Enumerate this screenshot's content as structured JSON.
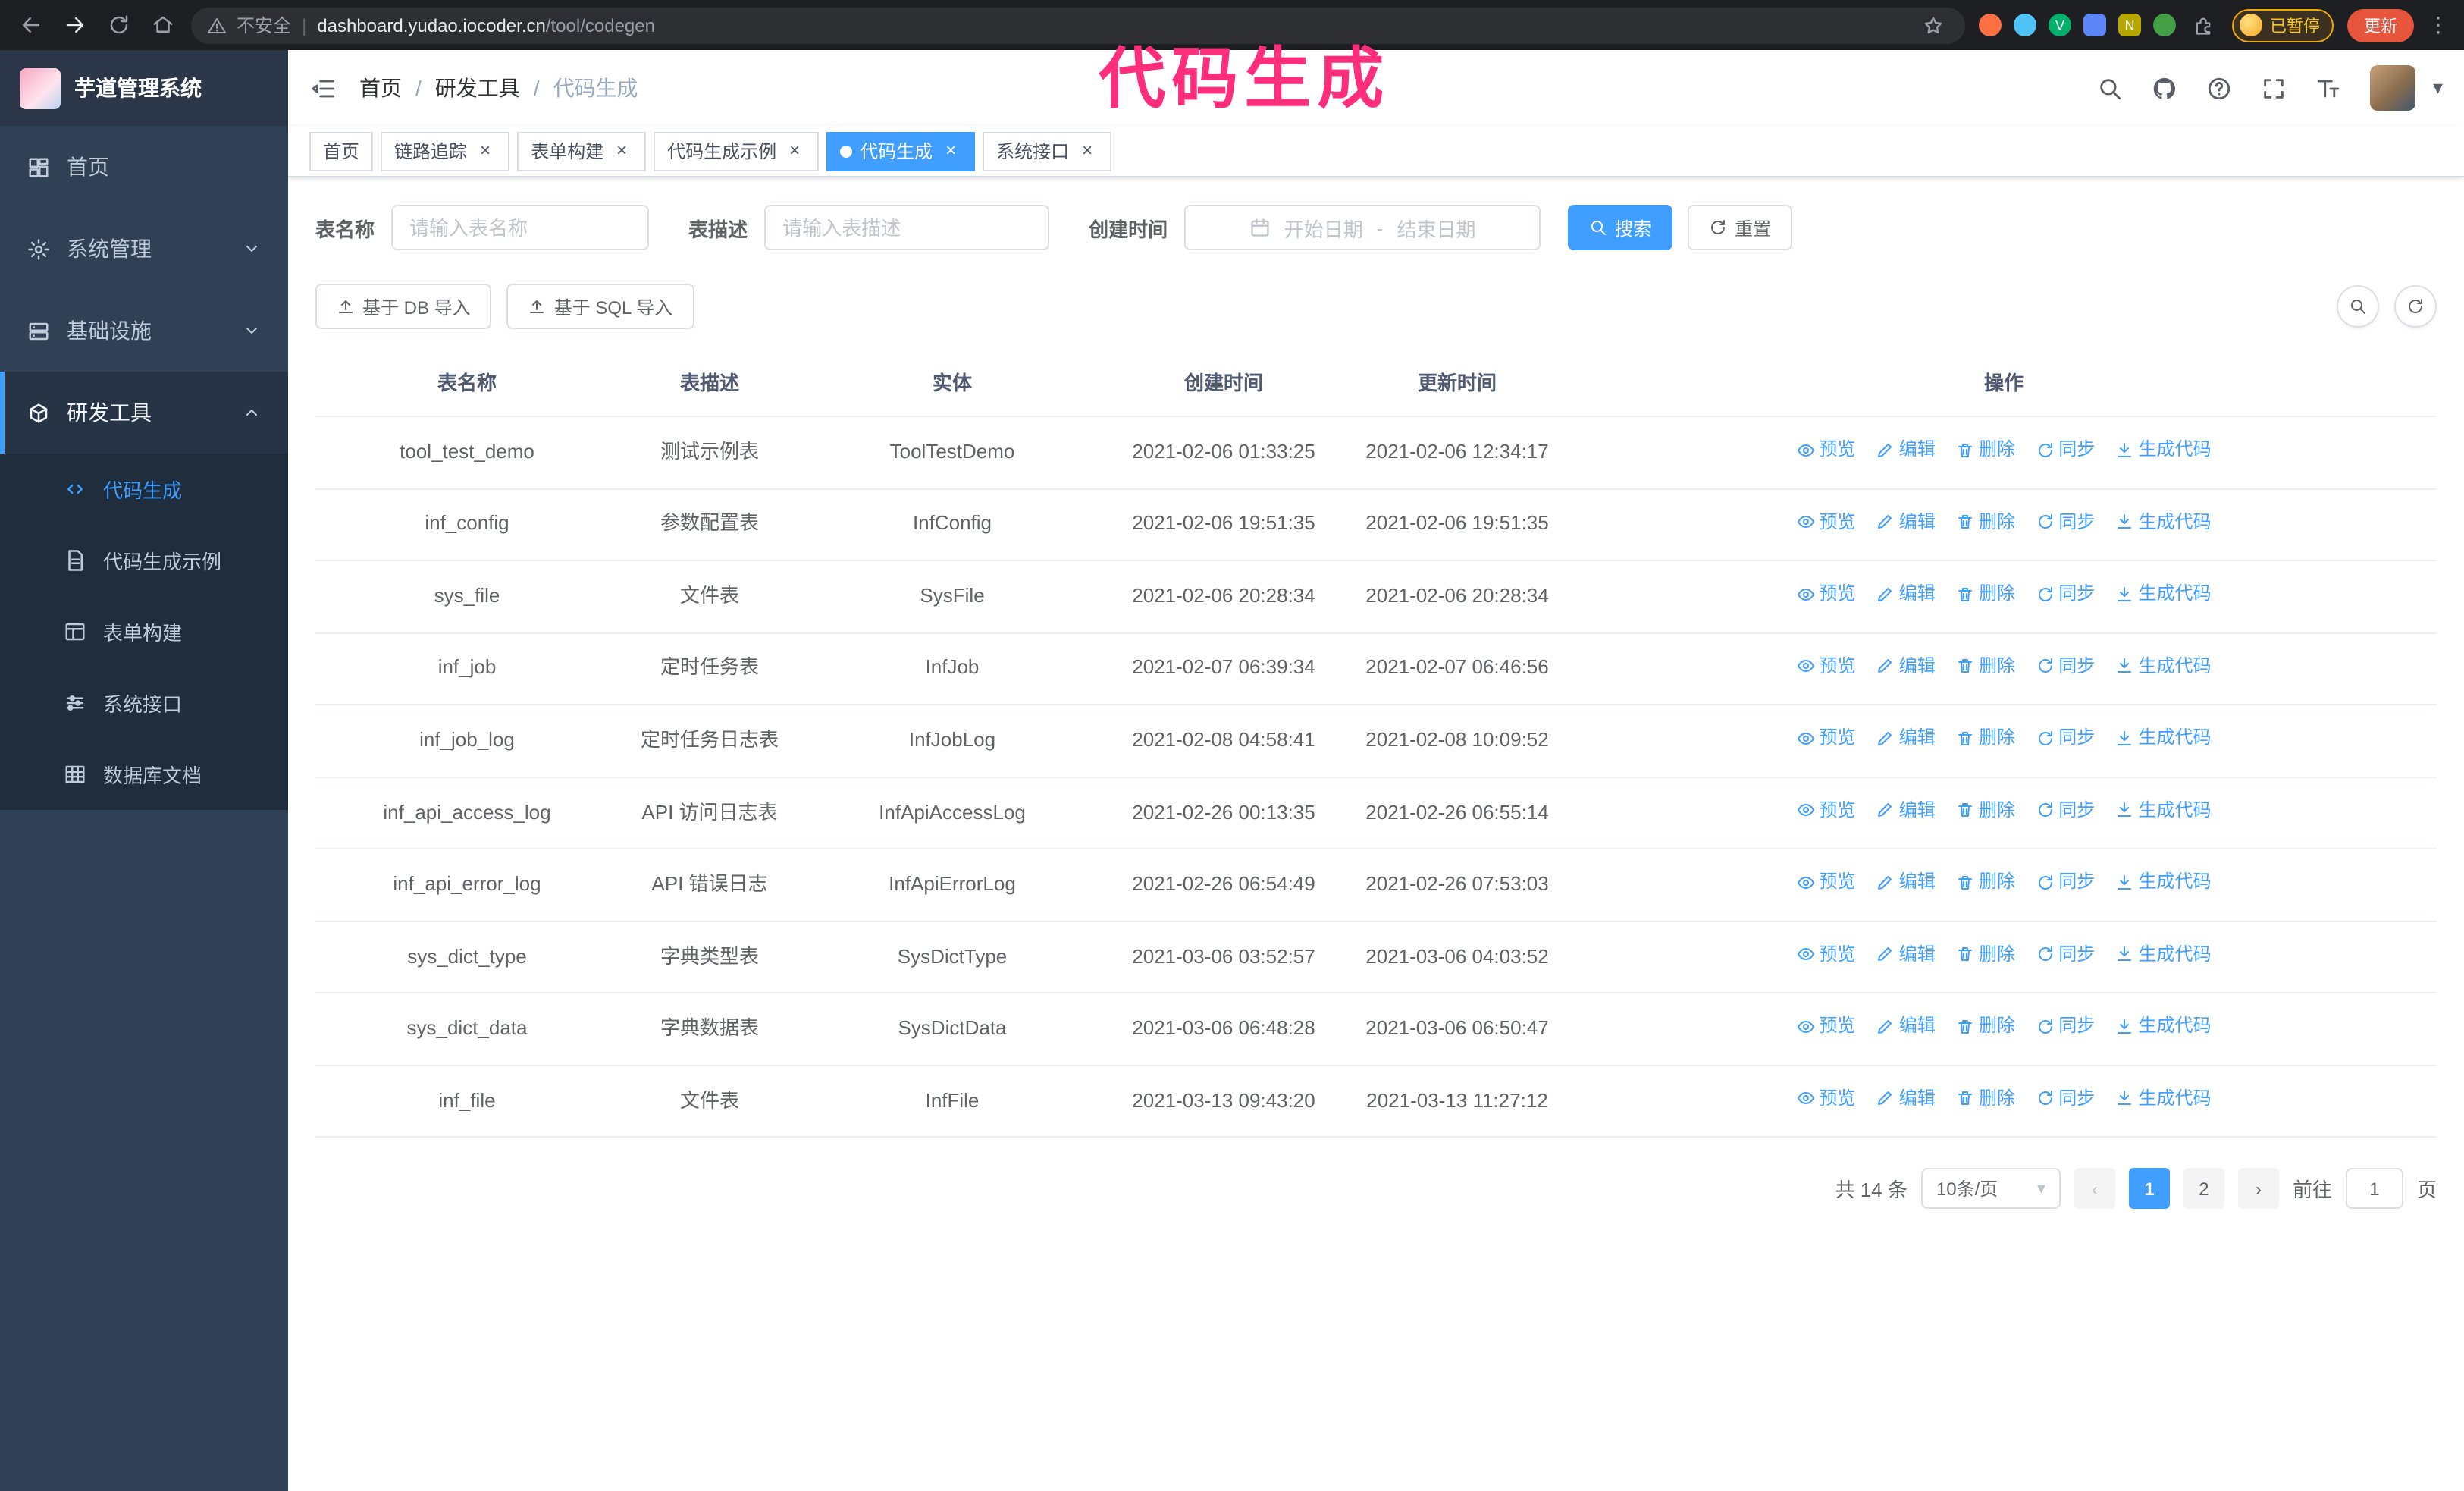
{
  "annotation": {
    "text": "代码生成",
    "color": "#ff2e7c"
  },
  "browser": {
    "security_label": "不安全",
    "url_host": "dashboard.yudao.iocoder.cn",
    "url_path": "/tool/codegen",
    "profile_badge": "已暂停",
    "update_button": "更新"
  },
  "icons": {
    "close": "×",
    "caret_down": "▾",
    "kebab": "⋮",
    "prev": "‹",
    "next": "›",
    "divider": "|",
    "date_separator": "-"
  },
  "sidebar": {
    "logo_title": "芋道管理系统",
    "menu": [
      {
        "label": "首页"
      },
      {
        "label": "系统管理"
      },
      {
        "label": "基础设施"
      },
      {
        "label": "研发工具"
      }
    ],
    "dev_submenu": [
      {
        "label": "代码生成"
      },
      {
        "label": "代码生成示例"
      },
      {
        "label": "表单构建"
      },
      {
        "label": "系统接口"
      },
      {
        "label": "数据库文档"
      }
    ]
  },
  "breadcrumb": {
    "items": [
      "首页",
      "研发工具",
      "代码生成"
    ],
    "separator": "/"
  },
  "tags": [
    {
      "label": "首页",
      "closable": false,
      "active": false
    },
    {
      "label": "链路追踪",
      "closable": true,
      "active": false
    },
    {
      "label": "表单构建",
      "closable": true,
      "active": false
    },
    {
      "label": "代码生成示例",
      "closable": true,
      "active": false
    },
    {
      "label": "代码生成",
      "closable": true,
      "active": true
    },
    {
      "label": "系统接口",
      "closable": true,
      "active": false
    }
  ],
  "filters": {
    "table_name_label": "表名称",
    "table_name_placeholder": "请输入表名称",
    "table_desc_label": "表描述",
    "table_desc_placeholder": "请输入表描述",
    "create_time_label": "创建时间",
    "date_start_placeholder": "开始日期",
    "date_end_placeholder": "结束日期",
    "search_button": "搜索",
    "reset_button": "重置"
  },
  "toolbar": {
    "import_db": "基于 DB 导入",
    "import_sql": "基于 SQL 导入"
  },
  "table": {
    "columns": [
      "表名称",
      "表描述",
      "实体",
      "创建时间",
      "更新时间",
      "操作"
    ],
    "actions": [
      "预览",
      "编辑",
      "删除",
      "同步",
      "生成代码"
    ],
    "rows": [
      {
        "name": "tool_test_demo",
        "desc": "测试示例表",
        "entity": "ToolTestDemo",
        "created": "2021-02-06 01:33:25",
        "updated": "2021-02-06 12:34:17"
      },
      {
        "name": "inf_config",
        "desc": "参数配置表",
        "entity": "InfConfig",
        "created": "2021-02-06 19:51:35",
        "updated": "2021-02-06 19:51:35"
      },
      {
        "name": "sys_file",
        "desc": "文件表",
        "entity": "SysFile",
        "created": "2021-02-06 20:28:34",
        "updated": "2021-02-06 20:28:34"
      },
      {
        "name": "inf_job",
        "desc": "定时任务表",
        "entity": "InfJob",
        "created": "2021-02-07 06:39:34",
        "updated": "2021-02-07 06:46:56"
      },
      {
        "name": "inf_job_log",
        "desc": "定时任务日志表",
        "entity": "InfJobLog",
        "created": "2021-02-08 04:58:41",
        "updated": "2021-02-08 10:09:52"
      },
      {
        "name": "inf_api_access_log",
        "desc": "API 访问日志表",
        "entity": "InfApiAccessLog",
        "created": "2021-02-26 00:13:35",
        "updated": "2021-02-26 06:55:14"
      },
      {
        "name": "inf_api_error_log",
        "desc": "API 错误日志",
        "entity": "InfApiErrorLog",
        "created": "2021-02-26 06:54:49",
        "updated": "2021-02-26 07:53:03"
      },
      {
        "name": "sys_dict_type",
        "desc": "字典类型表",
        "entity": "SysDictType",
        "created": "2021-03-06 03:52:57",
        "updated": "2021-03-06 04:03:52"
      },
      {
        "name": "sys_dict_data",
        "desc": "字典数据表",
        "entity": "SysDictData",
        "created": "2021-03-06 06:48:28",
        "updated": "2021-03-06 06:50:47"
      },
      {
        "name": "inf_file",
        "desc": "文件表",
        "entity": "InfFile",
        "created": "2021-03-13 09:43:20",
        "updated": "2021-03-13 11:27:12"
      }
    ]
  },
  "pagination": {
    "total": "共 14 条",
    "page_size": "10条/页",
    "pages": [
      "1",
      "2"
    ],
    "active_page": "1",
    "goto_label": "前往",
    "goto_value": "1",
    "goto_unit": "页"
  },
  "colors": {
    "accent": "#409EFF",
    "sidebar_bg": "#304156",
    "submenu_bg": "#1f2d3d"
  }
}
